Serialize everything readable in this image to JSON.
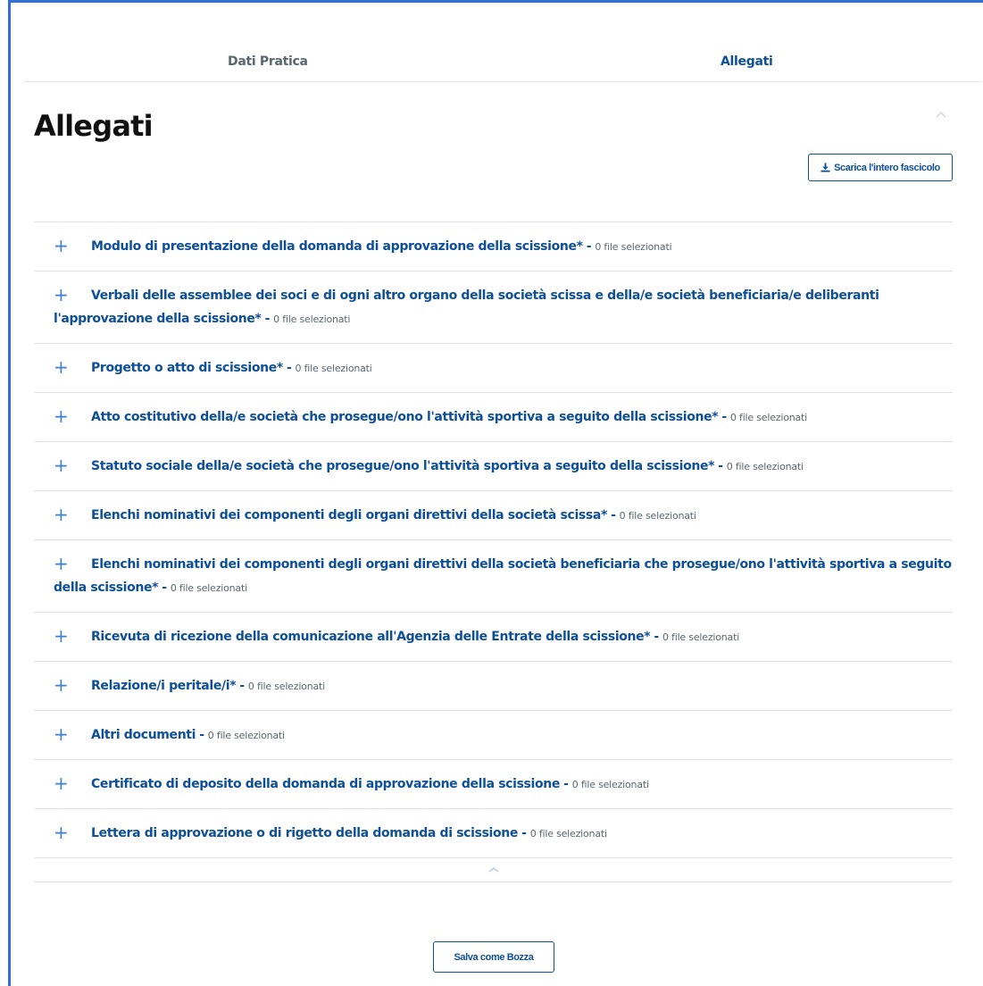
{
  "tabs": {
    "dati_pratica": "Dati Pratica",
    "allegati": "Allegati"
  },
  "section": {
    "title": "Allegati",
    "download_label": "Scarica l'intero fascicolo"
  },
  "count_text": "0 file selezionati",
  "attachments": [
    {
      "label": "Modulo di presentazione della domanda di approvazione della scissione*",
      "count": "0 file selezionati"
    },
    {
      "label": "Verbali delle assemblee dei soci e di ogni altro organo della società scissa e della/e società beneficiaria/e deliberanti l'approvazione della scissione*",
      "count": "0 file selezionati"
    },
    {
      "label": "Progetto o atto di scissione*",
      "count": "0 file selezionati"
    },
    {
      "label": "Atto costitutivo della/e società che prosegue/ono l'attività sportiva a seguito della scissione*",
      "count": "0 file selezionati"
    },
    {
      "label": "Statuto sociale della/e società che prosegue/ono l'attività sportiva a seguito della scissione*",
      "count": "0 file selezionati"
    },
    {
      "label": "Elenchi nominativi dei componenti degli organi direttivi della società scissa*",
      "count": "0 file selezionati"
    },
    {
      "label": "Elenchi nominativi dei componenti degli organi direttivi della società beneficiaria che prosegue/ono l'attività sportiva a seguito della scissione*",
      "count": "0 file selezionati"
    },
    {
      "label": "Ricevuta di ricezione della comunicazione all'Agenzia delle Entrate della scissione*",
      "count": "0 file selezionati"
    },
    {
      "label": "Relazione/i peritale/i*",
      "count": "0 file selezionati"
    },
    {
      "label": "Altri documenti",
      "count": "0 file selezionati"
    },
    {
      "label": "Certificato di deposito della domanda di approvazione della scissione",
      "count": "0 file selezionati"
    },
    {
      "label": "Lettera di approvazione o di rigetto della domanda di scissione",
      "count": "0 file selezionati"
    }
  ],
  "footer": {
    "save_draft_label": "Salva come Bozza"
  },
  "icons": {
    "expand": "plus-icon",
    "collapse": "chevron-up-icon",
    "download": "download-icon"
  },
  "colors": {
    "accent": "#0d4f9a",
    "plus": "#3d7fd6",
    "frame": "#2f6fd6"
  }
}
